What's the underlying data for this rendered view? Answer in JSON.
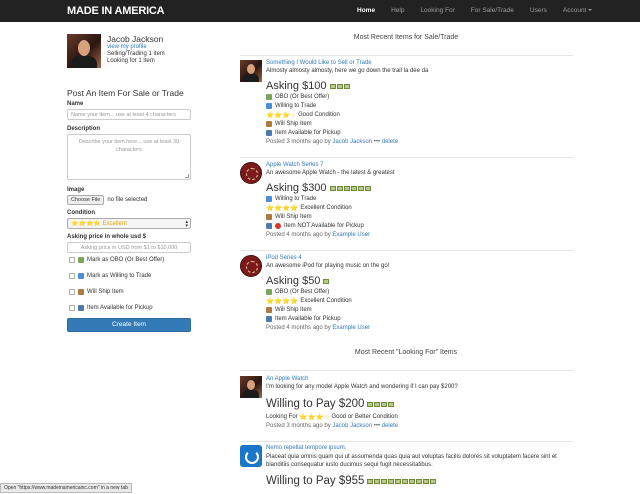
{
  "nav": {
    "brand": "MADE IN AMERICA",
    "links": [
      "Home",
      "Help",
      "Looking For",
      "For Sale/Trade",
      "Users",
      "Account"
    ]
  },
  "profile": {
    "name": "Jacob Jackson",
    "view_profile": "view my profile",
    "selling": "Selling/Trading 1 item",
    "looking": "Looking for 1 item"
  },
  "form": {
    "heading": "Post An Item For Sale or Trade",
    "name_label": "Name",
    "name_placeholder": "Name your item... use at least 4 characters",
    "desc_label": "Description",
    "desc_placeholder": "Describe your item here... use at least 30 characters",
    "image_label": "Image",
    "choose_file": "Choose File",
    "no_file": "no file selected",
    "condition_label": "Condition",
    "condition_value": "⭐⭐⭐⭐ Excellent",
    "price_label": "Asking price in whole usd $",
    "price_placeholder": "Asking price in USD from $1 to $10,000",
    "checks": [
      "Mark as OBO (Or Best Offer)",
      "Mark as Willing to Trade",
      "Will Ship Item",
      "Item Available for Pickup"
    ],
    "submit": "Create Item"
  },
  "sections": {
    "sale": "Most Recent Items for Sale/Trade",
    "looking": "Most Recent \"Looking For\" Items"
  },
  "sale_items": [
    {
      "title": "Something I Would Like to Sell or Trade",
      "desc": "Almosty almosty almosty, here we go down the trail la dee da",
      "price": "Asking $100",
      "bills": 3,
      "features": [
        "OBO (Or Best Offer)",
        "Willing to Trade",
        "Good Condition",
        "Will Ship Item",
        "Item Available for Pickup"
      ],
      "stars": "⭐⭐⭐☆",
      "posted": "Posted 3 months ago by",
      "author": "Jacob Jackson",
      "dots": "•••",
      "delete": "delete"
    },
    {
      "title": "Apple Watch Series 7",
      "desc": "An awesome Apple Watch - the latest & greatest",
      "price": "Asking $300",
      "bills": 6,
      "features": [
        "Willing to Trade",
        "Excellent Condition",
        "Will Ship Item",
        "Item NOT Available for Pickup"
      ],
      "stars": "⭐⭐⭐⭐",
      "posted": "Posted 4 months ago by",
      "author": "Example User"
    },
    {
      "title": "iPod Series 4",
      "desc": "An awesome iPod for playing music on the go!",
      "price": "Asking $50",
      "bills": 1,
      "features": [
        "OBO (Or Best Offer)",
        "Excellent Condition",
        "Will Ship Item",
        "Item Available for Pickup"
      ],
      "stars": "⭐⭐⭐⭐",
      "posted": "Posted 4 months ago by",
      "author": "Example User"
    }
  ],
  "looking_items": [
    {
      "title": "An Apple Watch",
      "desc": "I'm looking for any model Apple Watch and wondering if I can pay $200?",
      "price": "Willing to Pay $200",
      "bills": 4,
      "looking_for": "Looking For",
      "stars": "⭐⭐⭐☆",
      "condition": "Good or Better Condition",
      "posted": "Posted 3 months ago by",
      "author": "Jacob Jackson",
      "dots": "•••",
      "delete": "delete"
    },
    {
      "title": "Nemo repellat tempore ipsum.",
      "desc": "Placeat quia omnis quam qui ut assumenda quas quia aut voluptas facilis dolores sit voluptatem facere sint et blanditiis consequatur iusto ducimus sequi fugit necessitatibus.",
      "price": "Willing to Pay $955",
      "bills": 10
    }
  ],
  "status_tooltip": "Open \"https://www.madeinamericainc.com\" in a new tab"
}
